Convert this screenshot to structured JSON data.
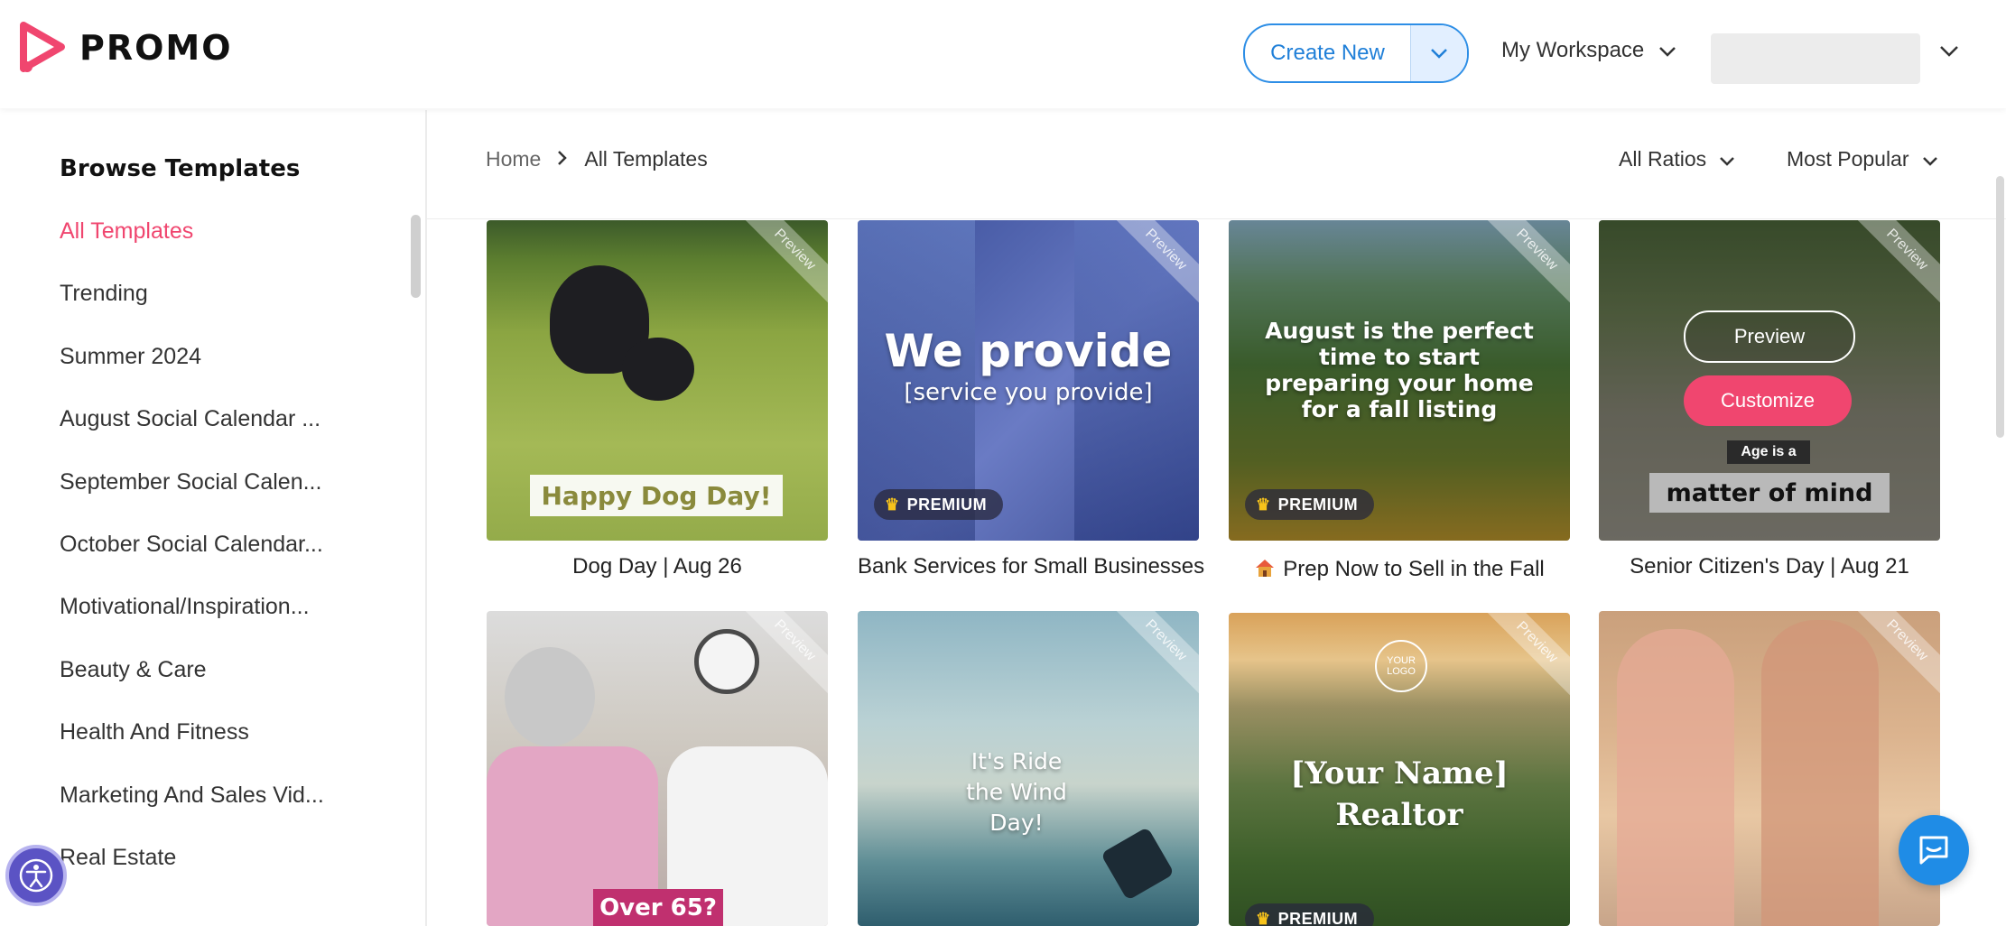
{
  "app": {
    "logo_text": "PROMO",
    "brand_color": "#f0466f",
    "accent_color": "#1f7fd8"
  },
  "header": {
    "create_new_label": "Create New",
    "workspace_label": "My Workspace"
  },
  "sidebar": {
    "title": "Browse Templates",
    "items": [
      {
        "label": "All Templates",
        "active": true
      },
      {
        "label": "Trending"
      },
      {
        "label": "Summer 2024"
      },
      {
        "label": "August Social Calendar ..."
      },
      {
        "label": "September Social Calen..."
      },
      {
        "label": "October Social Calendar..."
      },
      {
        "label": "Motivational/Inspiration..."
      },
      {
        "label": "Beauty & Care"
      },
      {
        "label": "Health And Fitness"
      },
      {
        "label": "Marketing And Sales Vid..."
      },
      {
        "label": "Real Estate"
      }
    ]
  },
  "breadcrumb": {
    "home": "Home",
    "current": "All Templates"
  },
  "filters": {
    "ratio": "All Ratios",
    "sort": "Most Popular"
  },
  "cards": [
    {
      "title": "Dog Day | Aug 26",
      "ribbon": "Preview",
      "overlay": "Happy Dog Day!"
    },
    {
      "title": "Bank Services for Small Businesses",
      "ribbon": "Preview",
      "overlay_main": "We provide",
      "overlay_sub": "[service you provide]",
      "badge": "PREMIUM"
    },
    {
      "title": "Prep Now to Sell in the Fall",
      "ribbon": "Preview",
      "overlay": "August is the perfect time to start preparing your home for a fall listing",
      "badge": "PREMIUM"
    },
    {
      "title": "Senior Citizen's Day | Aug 21",
      "ribbon": "Preview",
      "overlay_small": "Age is a",
      "overlay": "matter of mind",
      "preview_label": "Preview",
      "customize_label": "Customize"
    },
    {
      "ribbon": "Preview",
      "overlay": "Over 65?"
    },
    {
      "ribbon": "Preview",
      "overlay": "It's Ride the Wind Day!"
    },
    {
      "ribbon": "Preview",
      "logo_text": "YOUR LOGO",
      "overlay_main": "[Your Name]",
      "overlay_sub": "Realtor",
      "badge": "PREMIUM"
    },
    {
      "ribbon": "Preview"
    }
  ]
}
